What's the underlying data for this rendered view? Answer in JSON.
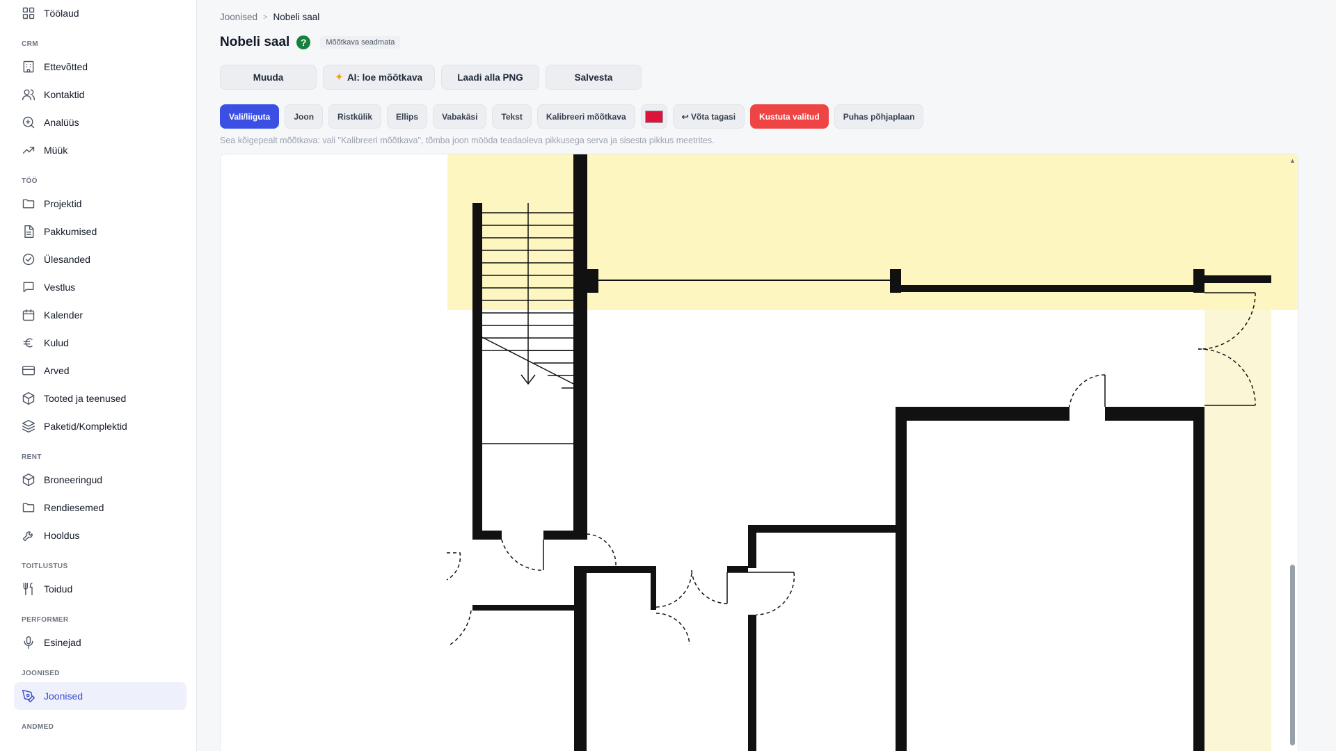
{
  "sidebar": {
    "sections": [
      {
        "label": "",
        "items": [
          {
            "label": "Töölaud",
            "icon": "dashboard-icon"
          }
        ]
      },
      {
        "label": "CRM",
        "items": [
          {
            "label": "Ettevõtted",
            "icon": "building-icon"
          },
          {
            "label": "Kontaktid",
            "icon": "users-icon"
          },
          {
            "label": "Analüüs",
            "icon": "zoom-in-icon"
          },
          {
            "label": "Müük",
            "icon": "trending-up-icon"
          }
        ]
      },
      {
        "label": "TÖÖ",
        "items": [
          {
            "label": "Projektid",
            "icon": "folder-icon"
          },
          {
            "label": "Pakkumised",
            "icon": "file-text-icon"
          },
          {
            "label": "Ülesanded",
            "icon": "check-circle-icon"
          },
          {
            "label": "Vestlus",
            "icon": "message-square-icon"
          },
          {
            "label": "Kalender",
            "icon": "calendar-icon"
          },
          {
            "label": "Kulud",
            "icon": "euro-icon"
          },
          {
            "label": "Arved",
            "icon": "credit-card-icon"
          },
          {
            "label": "Tooted ja teenused",
            "icon": "package-icon"
          },
          {
            "label": "Paketid/Komplektid",
            "icon": "layers-icon"
          }
        ]
      },
      {
        "label": "RENT",
        "items": [
          {
            "label": "Broneeringud",
            "icon": "package-icon"
          },
          {
            "label": "Rendiesemed",
            "icon": "folder-icon"
          },
          {
            "label": "Hooldus",
            "icon": "wrench-icon"
          }
        ]
      },
      {
        "label": "TOITLUSTUS",
        "items": [
          {
            "label": "Toidud",
            "icon": "utensils-icon"
          }
        ]
      },
      {
        "label": "PERFORMER",
        "items": [
          {
            "label": "Esinejad",
            "icon": "microphone-icon"
          }
        ]
      },
      {
        "label": "JOONISED",
        "items": [
          {
            "label": "Joonised",
            "icon": "pen-tool-icon",
            "active": true
          }
        ]
      },
      {
        "label": "ANDMED",
        "items": []
      }
    ]
  },
  "breadcrumb": {
    "parent": "Joonised",
    "separator": ">",
    "current": "Nobeli saal"
  },
  "page": {
    "title": "Nobeli saal",
    "help": "?",
    "scale_status": "Mõõtkava seadmata"
  },
  "actions": {
    "edit": "Muuda",
    "ai_read": "AI: loe mõõtkava",
    "ai_icon": "sparkle-icon",
    "download": "Laadi alla PNG",
    "save": "Salvesta"
  },
  "tools": {
    "select": "Vali/liiguta",
    "line": "Joon",
    "rect": "Ristkülik",
    "ellipse": "Ellips",
    "freehand": "Vabakäsi",
    "text": "Tekst",
    "calibrate": "Kalibreeri mõõtkava",
    "undo": "↩ Võta tagasi",
    "delete_selected": "Kustuta valitud",
    "clear": "Puhas põhjaplaan"
  },
  "colors": {
    "active_tool": "#3b4fe4",
    "danger": "#ef4444",
    "draw_color": "#dc143c",
    "highlight_yellow": "#fdf6c0",
    "accent": "#3b4cca"
  },
  "hint": "Sea kõigepealt mõõtkava: vali \"Kalibreeri mõõtkava\", tõmba joon mööda teadaoleva pikkusega serva ja sisesta pikkus meetrites."
}
